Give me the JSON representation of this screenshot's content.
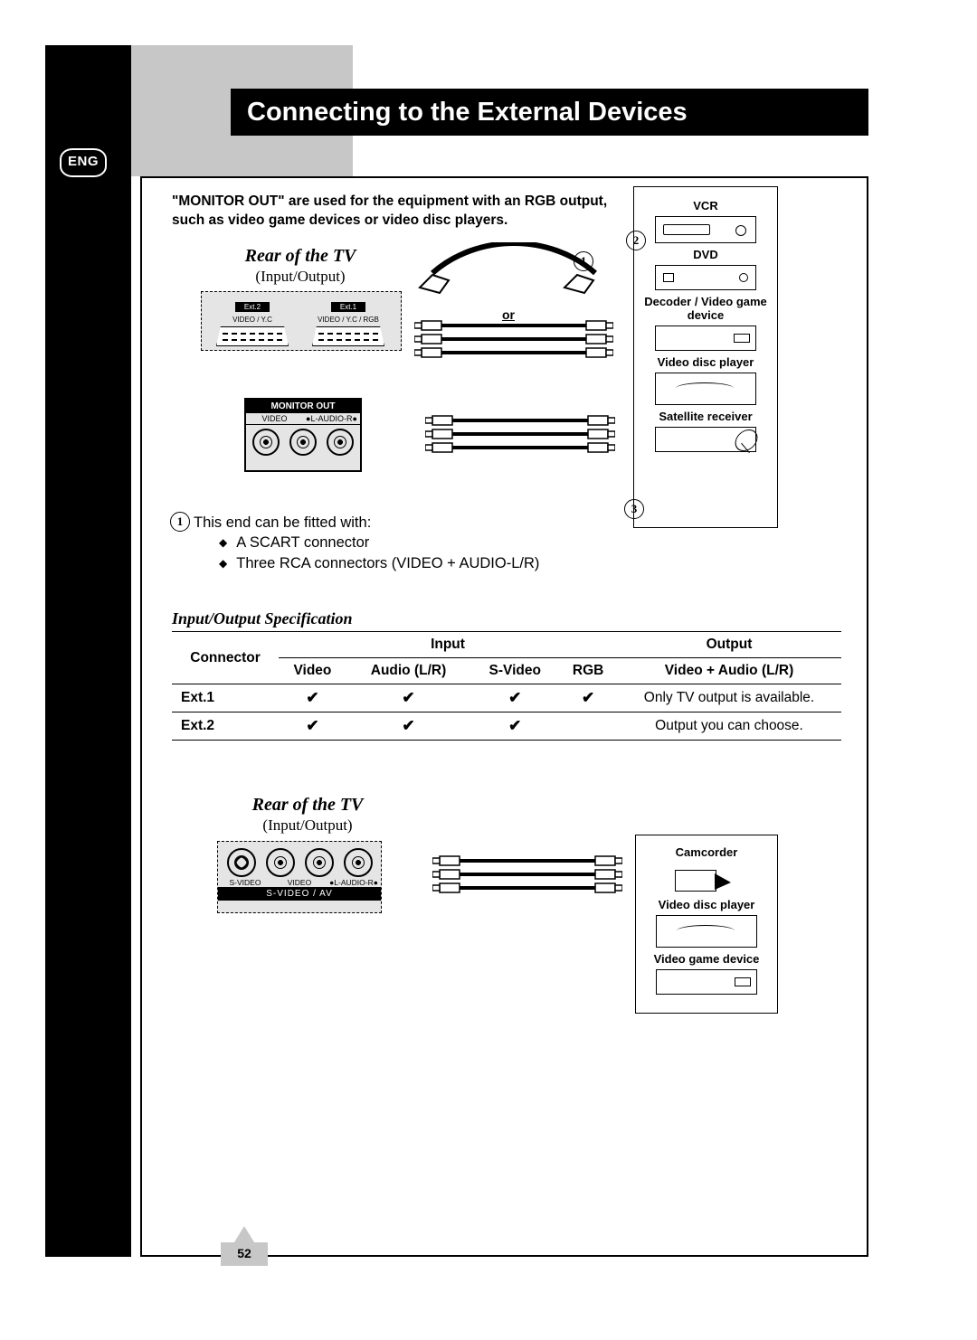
{
  "lang_badge": "ENG",
  "title": "Connecting to the External Devices",
  "intro": "\"MONITOR OUT\" are used for the equipment with an RGB output, such as video game devices or video disc players.",
  "rear_label": "Rear of the TV",
  "io_sub": "(Input/Output)",
  "scart": {
    "ext2_name": "Ext.2",
    "ext2_type": "VIDEO / Y.C",
    "ext1_name": "Ext.1",
    "ext1_type": "VIDEO / Y.C / RGB"
  },
  "monitor_out": {
    "title": "MONITOR OUT",
    "video": "VIDEO",
    "audio_l": "L",
    "audio": "AUDIO",
    "audio_r": "R"
  },
  "or_label": "or",
  "callouts": {
    "c1": "1",
    "c2": "2",
    "c3": "3"
  },
  "devices": {
    "vcr": "VCR",
    "dvd": "DVD",
    "decoder": "Decoder / Video game device",
    "disc": "Video disc player",
    "sat": "Satellite receiver"
  },
  "fitted": {
    "lead": "This end can be fitted with:",
    "a": "A SCART connector",
    "b": "Three RCA connectors (VIDEO + AUDIO-L/R)"
  },
  "spec_heading": "Input/Output Specification",
  "table": {
    "hdr_connector": "Connector",
    "hdr_input": "Input",
    "hdr_output": "Output",
    "sub_video": "Video",
    "sub_audio": "Audio (L/R)",
    "sub_svideo": "S-Video",
    "sub_rgb": "RGB",
    "sub_out": "Video + Audio (L/R)",
    "rows": [
      {
        "name": "Ext.1",
        "video": "✔",
        "audio": "✔",
        "svideo": "✔",
        "rgb": "✔",
        "out": "Only TV output is available."
      },
      {
        "name": "Ext.2",
        "video": "✔",
        "audio": "✔",
        "svideo": "✔",
        "rgb": "",
        "out": "Output you can choose."
      }
    ]
  },
  "svideo_panel": {
    "svideo": "S-VIDEO",
    "video": "VIDEO",
    "l": "L",
    "audio": "AUDIO",
    "r": "R",
    "footer": "S-VIDEO / AV"
  },
  "devices2": {
    "cam": "Camcorder",
    "disc": "Video disc player",
    "game": "Video game device"
  },
  "page_number": "52"
}
